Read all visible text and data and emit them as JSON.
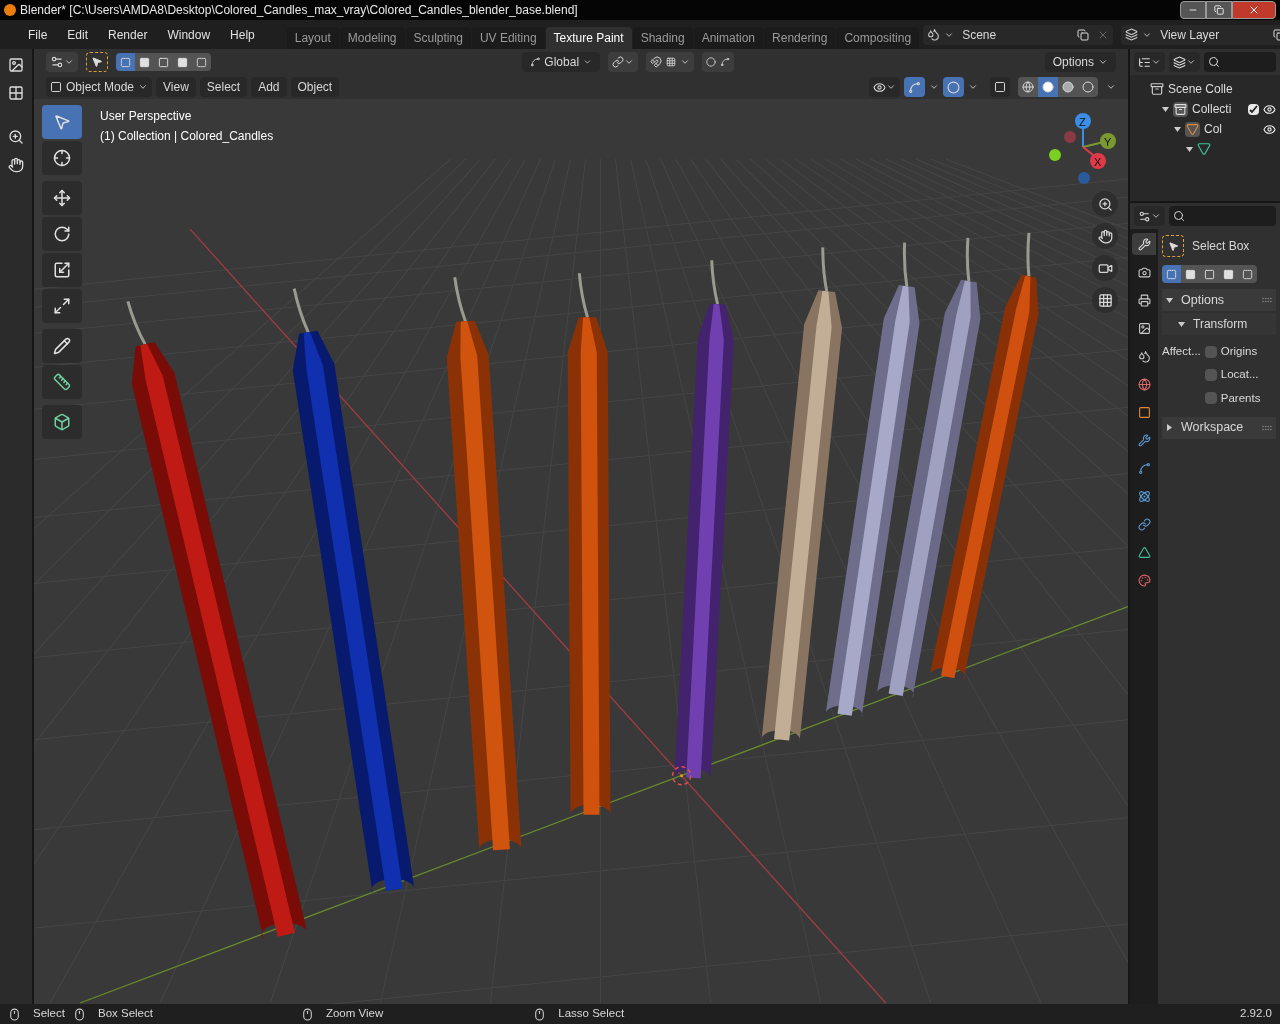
{
  "title_bar": {
    "title": "Blender* [C:\\Users\\AMDA8\\Desktop\\Colored_Candles_max_vray\\Colored_Candles_blender_base.blend]"
  },
  "menu": [
    "File",
    "Edit",
    "Render",
    "Window",
    "Help"
  ],
  "workspace_tabs": [
    {
      "label": "Layout",
      "selected": false
    },
    {
      "label": "Modeling",
      "selected": false
    },
    {
      "label": "Sculpting",
      "selected": false
    },
    {
      "label": "UV Editing",
      "selected": false
    },
    {
      "label": "Texture Paint",
      "selected": true
    },
    {
      "label": "Shading",
      "selected": false
    },
    {
      "label": "Animation",
      "selected": false
    },
    {
      "label": "Rendering",
      "selected": false
    },
    {
      "label": "Compositing",
      "selected": false
    }
  ],
  "scene": "Scene",
  "view_layer": "View Layer",
  "tool_header": {
    "select_modes": [
      {
        "selected": true
      },
      {
        "selected": false
      },
      {
        "selected": false
      },
      {
        "selected": false
      },
      {
        "selected": false
      }
    ],
    "orientation": "Global",
    "snap": {
      "on": false
    },
    "proportional": {
      "on": false
    },
    "options": "Options"
  },
  "viewport_header": {
    "mode": "Object Mode",
    "menus": [
      "View",
      "Select",
      "Add",
      "Object"
    ],
    "shading_modes": [
      {
        "selected": false
      },
      {
        "selected": true
      },
      {
        "selected": false
      },
      {
        "selected": false
      }
    ]
  },
  "overlay_text": [
    "User Perspective",
    "(1) Collection | Colored_Candles"
  ],
  "toolbar": [
    {
      "selected": true
    },
    {
      "selected": false
    },
    {
      "selected": false
    },
    {
      "selected": false
    },
    {
      "selected": false
    },
    {
      "selected": false
    },
    {
      "selected": false
    },
    {
      "selected": false
    },
    {
      "selected": false
    }
  ],
  "gizmo": {
    "z": "Z",
    "y": "Y",
    "x": "X"
  },
  "outliner": [
    {
      "label": "Scene Colle",
      "kind": "scene",
      "children": [
        {
          "label": "Collecti",
          "kind": "collection",
          "expanded": true,
          "checked": true,
          "visible": true,
          "children": [
            {
              "label": "Col",
              "kind": "object",
              "expanded": true,
              "visible": true,
              "children": [
                {
                  "kind": "mesh",
                  "expanded": true
                }
              ]
            }
          ]
        }
      ]
    }
  ],
  "properties": {
    "property_tabs": [
      {
        "selected": true
      },
      {
        "selected": false
      },
      {
        "selected": false
      },
      {
        "selected": false
      },
      {
        "selected": false
      },
      {
        "selected": false
      },
      {
        "selected": false
      },
      {
        "selected": false
      },
      {
        "selected": false
      },
      {
        "selected": false
      },
      {
        "selected": false
      },
      {
        "selected": false
      },
      {
        "selected": false
      }
    ],
    "tool_name": "Select Box",
    "select_modes": [
      {
        "selected": true
      },
      {
        "selected": false
      },
      {
        "selected": false
      },
      {
        "selected": false
      },
      {
        "selected": false
      }
    ],
    "panels": [
      {
        "label": "Options",
        "expanded": true,
        "children": [
          {
            "label": "Transform",
            "expanded": true
          }
        ]
      },
      {
        "label": "Workspace",
        "expanded": false
      }
    ],
    "affect_label": "Affect...",
    "checkboxes": [
      {
        "label": "Origins",
        "checked": false
      },
      {
        "label": "Locat...",
        "checked": false
      },
      {
        "label": "Parents",
        "checked": false
      }
    ]
  },
  "status_bar": {
    "hints": [
      "Select",
      "Box Select",
      "Zoom View",
      "Lasso Select"
    ],
    "version": "2.92.0"
  }
}
